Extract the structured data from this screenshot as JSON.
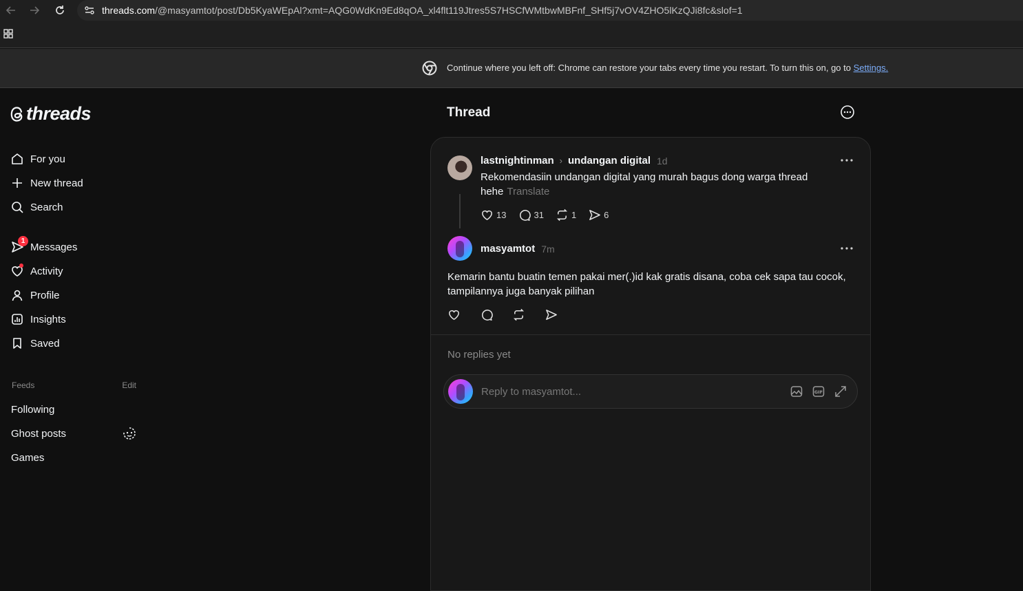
{
  "browser": {
    "url_host": "threads.com",
    "url_path": "/@masyamtot/post/Db5KyaWEpAl?xmt=AQG0WdKn9Ed8qOA_xl4flt119Jtres5S7HSCfWMtbwMBFnf_SHf5j7vOV4ZHO5lKzQJi8fc&slof=1",
    "infobar_message": "Continue where you left off: Chrome can restore your tabs every time you restart. To turn this on, go to ",
    "infobar_link": "Settings."
  },
  "logo": {
    "wordmark": "threads"
  },
  "sidebar": {
    "nav": [
      {
        "label": "For you",
        "icon": "home-icon"
      },
      {
        "label": "New thread",
        "icon": "plus-icon"
      },
      {
        "label": "Search",
        "icon": "search-icon"
      },
      {
        "label": "Messages",
        "icon": "send-icon",
        "badge": "1"
      },
      {
        "label": "Activity",
        "icon": "heart-icon"
      },
      {
        "label": "Profile",
        "icon": "person-icon"
      },
      {
        "label": "Insights",
        "icon": "chart-icon"
      },
      {
        "label": "Saved",
        "icon": "bookmark-icon"
      }
    ],
    "feeds_label": "Feeds",
    "feeds_edit": "Edit",
    "feeds": [
      {
        "label": "Following"
      },
      {
        "label": "Ghost posts"
      },
      {
        "label": "Games"
      }
    ]
  },
  "thread": {
    "title": "Thread",
    "original_post": {
      "user": "lastnightinman",
      "topic": "undangan digital",
      "time": "1d",
      "text_line1": "Rekomendasiin undangan digital yang murah bagus dong warga thread",
      "text_line2": "hehe",
      "translate_label": "Translate",
      "likes": "13",
      "replies": "31",
      "reposts": "1",
      "shares": "6"
    },
    "reply_post": {
      "user": "masyamtot",
      "time": "7m",
      "text_line1": "Kemarin bantu buatin temen pakai mer(.)id kak gratis disana, coba cek sapa tau cocok,",
      "text_line2": "tampilannya juga banyak pilihan"
    },
    "no_replies": "No replies yet",
    "reply_placeholder": "Reply to masyamtot..."
  },
  "colors": {
    "background": "#101010",
    "card": "#181818",
    "text": "#f3f5f7",
    "muted": "#777777",
    "badge": "#ff3040",
    "link": "#7cacf8"
  }
}
